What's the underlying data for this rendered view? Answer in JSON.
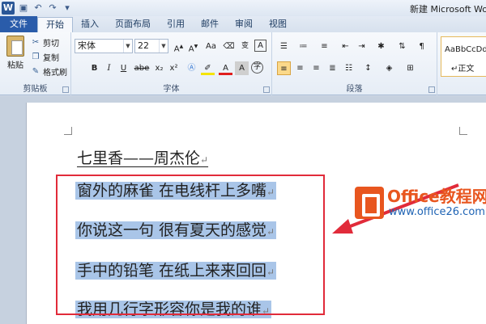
{
  "titlebar": {
    "app_icon": "W",
    "title": "新建 Microsoft Wo",
    "qat": [
      "save-icon",
      "undo-icon",
      "redo-icon",
      "customize-icon"
    ]
  },
  "tabs": [
    {
      "label": "文件"
    },
    {
      "label": "开始"
    },
    {
      "label": "插入"
    },
    {
      "label": "页面布局"
    },
    {
      "label": "引用"
    },
    {
      "label": "邮件"
    },
    {
      "label": "审阅"
    },
    {
      "label": "视图"
    }
  ],
  "clipboard": {
    "paste": "粘贴",
    "cut": "剪切",
    "copy": "复制",
    "format_painter": "格式刷",
    "group_label": "剪贴板"
  },
  "font": {
    "name": "宋体",
    "size": "22",
    "group_label": "字体",
    "aa": "Aa",
    "wen": "变",
    "a": "A",
    "b": "B",
    "i": "I",
    "u": "U",
    "abe": "abe",
    "x2sub": "x₂",
    "x2sup": "x²",
    "zi": "字"
  },
  "paragraph": {
    "group_label": "段落"
  },
  "styles": {
    "sample": "AaBbCcDd",
    "name": "↵正文"
  },
  "document": {
    "title": "七里香——周杰伦",
    "lines": [
      "窗外的麻雀  在电线杆上多嘴",
      "你说这一句  很有夏天的感觉",
      "手中的铅笔  在纸上来来回回",
      "我用几行字形容你是我的谁"
    ],
    "para_mark": "↵"
  },
  "watermark": {
    "brand": "Office教程网",
    "url": "www.office26.com"
  }
}
